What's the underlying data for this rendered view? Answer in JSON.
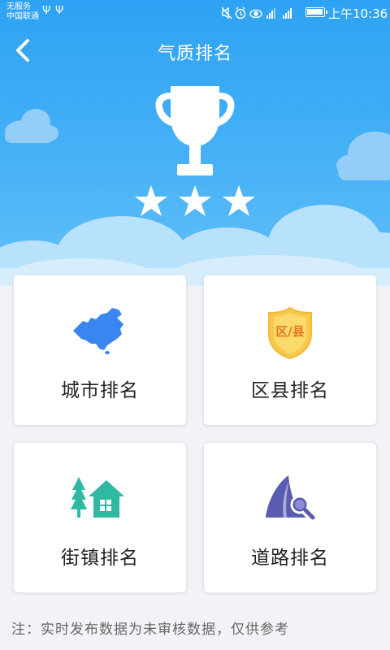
{
  "status_bar": {
    "carrier_line1": "无服务",
    "carrier_line2": "中国联通",
    "usb1": "Ψ",
    "usb2": "Ψ",
    "icons": "🔇⏰👁 ▮▮",
    "time": "上午10:36"
  },
  "header": {
    "title": "气质排名",
    "back_icon": "chevron-left-icon"
  },
  "colors": {
    "hero_top": "#2ea2f4",
    "hero_bottom": "#63c0f8",
    "city_icon": "#3a86f0",
    "district_icon": "#f7c94a",
    "street_icon": "#2fb9a3",
    "road_icon": "#5a5cb0"
  },
  "cards": {
    "city": {
      "label": "城市排名",
      "icon": "china-map-icon"
    },
    "district": {
      "label": "区县排名",
      "icon": "district-shield-icon",
      "badge": "区/县"
    },
    "street": {
      "label": "街镇排名",
      "icon": "house-tree-icon"
    },
    "road": {
      "label": "道路排名",
      "icon": "road-search-icon"
    }
  },
  "note": "注：实时发布数据为未审核数据，仅供参考"
}
